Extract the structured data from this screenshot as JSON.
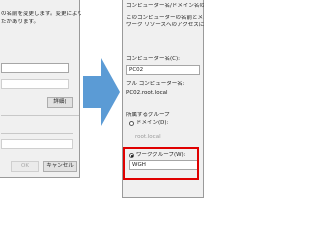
{
  "left_dialog": {
    "desc_line1": "の名前を変更します。変更により、ネット",
    "desc_line2": "たがあります。",
    "more_button": "詳細(",
    "ok_button": "OK",
    "cancel_button": "キャンセル"
  },
  "right_dialog": {
    "title": "コンピューター名/ドメイン名の変更",
    "desc_line1": "このコンピューターの名前とメンバーシップを変更",
    "desc_line2": "ワーク リソースへのアクセスに影響する場合があ",
    "computer_name_label": "コンピューター名(C):",
    "computer_name_value": "PC02",
    "full_name_label": "フル コンピューター名:",
    "full_name_value": "PC02.root.local",
    "member_of_label": "所属するグループ",
    "domain_label": "ドメイン(D):",
    "domain_value": "root.local",
    "workgroup_label": "ワークグループ(W):",
    "workgroup_value": "WGH"
  },
  "colors": {
    "arrow": "#5b9bd5",
    "highlight_border": "#e00000"
  }
}
